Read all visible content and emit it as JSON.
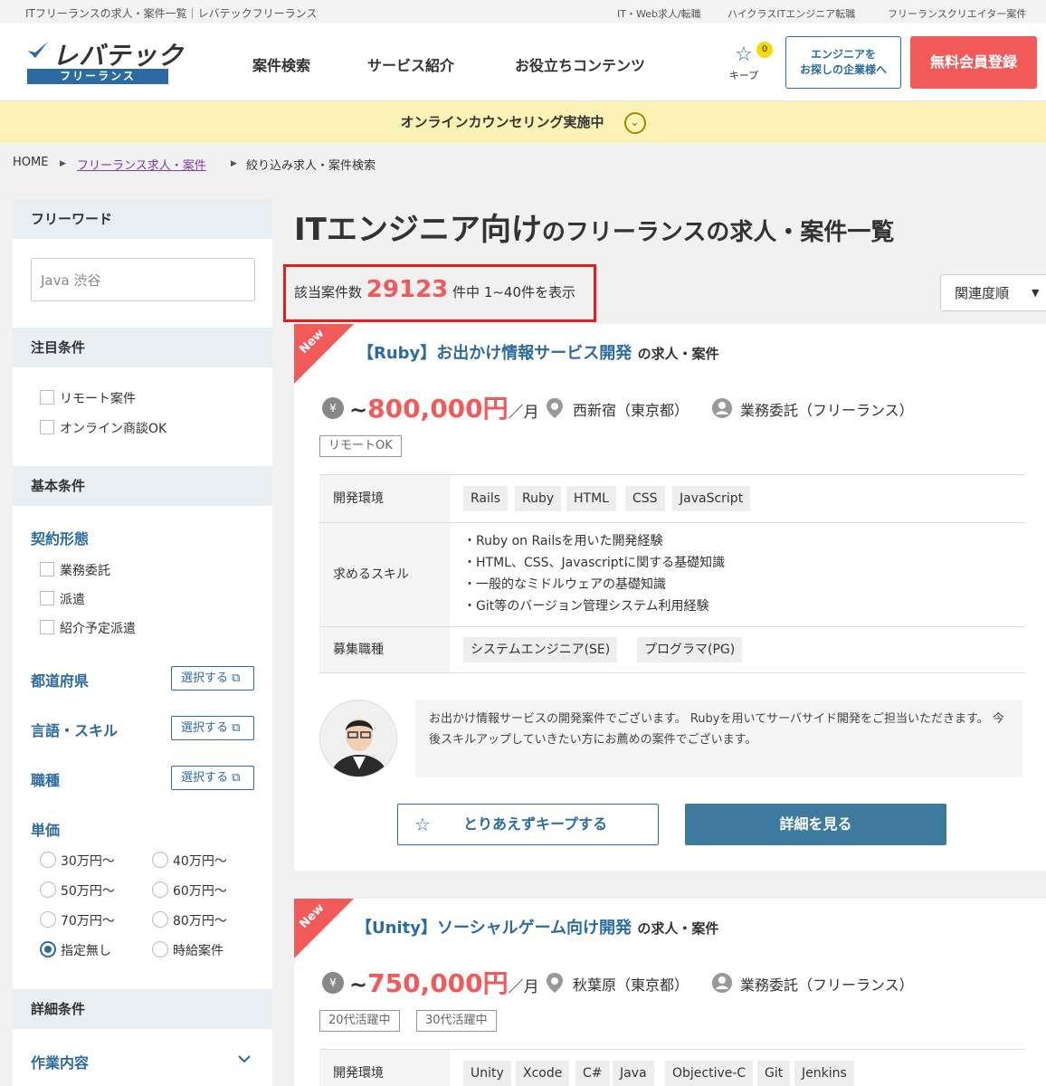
{
  "topbar": {
    "site_title": "ITフリーランスの求人・案件一覧｜レバテックフリーランス",
    "links": [
      "IT・Web求人/転職",
      "ハイクラスITエンジニア転職",
      "フリーランスクリエイター案件"
    ]
  },
  "header": {
    "logo_main": "レバテック",
    "logo_sub": "フリーランス",
    "nav": [
      "案件検索",
      "サービス紹介",
      "お役立ちコンテンツ"
    ],
    "keep_label": "キープ",
    "keep_count": "0",
    "corp_line1": "エンジニアを",
    "corp_line2": "お探しの企業様へ",
    "register": "無料会員登録"
  },
  "banner": {
    "text": "オンラインカウンセリング実施中"
  },
  "breadcrumb": {
    "home": "HOME",
    "level2": "フリーランス求人・案件",
    "current": "絞り込み求人・案件検索"
  },
  "sidebar": {
    "freeword_head": "フリーワード",
    "freeword_value": "Java 渋谷",
    "featured_head": "注目条件",
    "featured": [
      "リモート案件",
      "オンライン商談OK"
    ],
    "basic_head": "基本条件",
    "contract_head": "契約形態",
    "contract": [
      "業務委託",
      "派遣",
      "紹介予定派遣"
    ],
    "pref": "都道府県",
    "skill": "言語・スキル",
    "job": "職種",
    "select_label": "選択する",
    "price_head": "単価",
    "prices": [
      "30万円〜",
      "40万円〜",
      "50万円〜",
      "60万円〜",
      "70万円〜",
      "80万円〜",
      "指定無し",
      "時給案件"
    ],
    "price_selected": "指定無し",
    "detail_head": "詳細条件",
    "work_head": "作業内容"
  },
  "main": {
    "title_big": "ITエンジニア向け",
    "title_small": "のフリーランスの求人・案件一覧",
    "count_prefix": "該当案件数",
    "count": "29123",
    "count_suffix": "件中 1~40件を表示",
    "sort": "関連度順"
  },
  "jobs": [
    {
      "new": "New",
      "title": "【Ruby】お出かけ情報サービス開発",
      "title_suffix": "の求人・案件",
      "yen": "¥",
      "tilde": "~",
      "price": "800,000円",
      "per": "／月",
      "location": "西新宿（東京都）",
      "contract": "業務委託（フリーランス）",
      "tags": [
        "リモートOK"
      ],
      "env_label": "開発環境",
      "env": [
        "Rails",
        "Ruby",
        "HTML",
        "CSS",
        "JavaScript"
      ],
      "skills_label": "求めるスキル",
      "skills": [
        "・Ruby on Railsを用いた開発経験",
        "・HTML、CSS、Javascriptに関する基礎知識",
        "・一般的なミドルウェアの基礎知識",
        "・Git等のバージョン管理システム利用経験"
      ],
      "role_label": "募集職種",
      "roles": [
        "システムエンジニア(SE)",
        "プログラマ(PG)"
      ],
      "comment": "お出かけ情報サービスの開発案件でございます。 Rubyを用いてサーバサイド開発をご担当いただきます。 今後スキルアップしていきたい方にお薦めの案件でございます。",
      "keep_btn": "とりあえずキープする",
      "detail_btn": "詳細を見る"
    },
    {
      "new": "New",
      "title": "【Unity】ソーシャルゲーム向け開発",
      "title_suffix": "の求人・案件",
      "yen": "¥",
      "tilde": "~",
      "price": "750,000円",
      "per": "／月",
      "location": "秋葉原（東京都）",
      "contract": "業務委託（フリーランス）",
      "tags": [
        "20代活躍中",
        "30代活躍中"
      ],
      "env_label": "開発環境",
      "env": [
        "Unity",
        "Xcode",
        "C#",
        "Java",
        "Objective-C",
        "Git",
        "Jenkins"
      ]
    }
  ]
}
